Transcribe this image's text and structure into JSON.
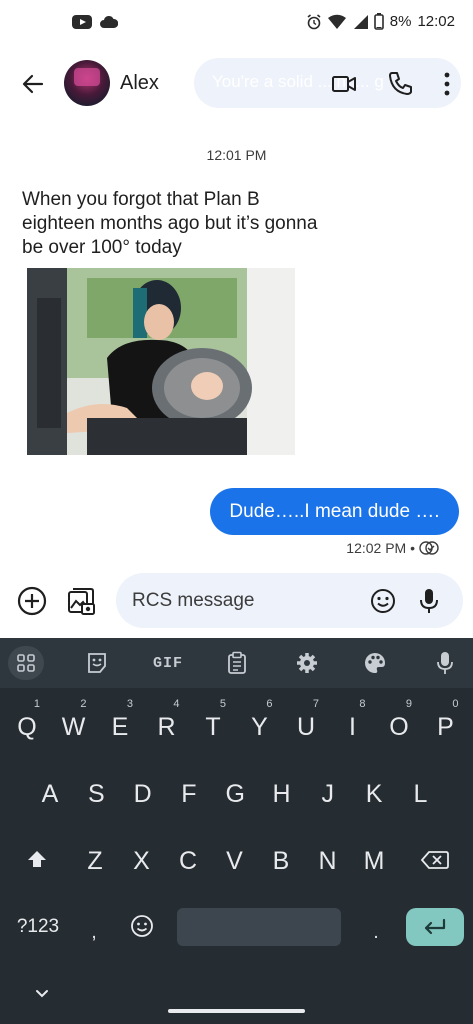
{
  "status_bar": {
    "battery": "8%",
    "time": "12:02",
    "icons": [
      "youtube-icon",
      "cloud-icon",
      "alarm-icon",
      "wifi-icon",
      "signal-icon",
      "battery-icon"
    ]
  },
  "header": {
    "contact_name": "Alex",
    "pill_text": "You're a solid ... nt ... g",
    "icons": [
      "back-arrow-icon",
      "video-call-icon",
      "phone-icon",
      "more-vert-icon"
    ]
  },
  "conversation": {
    "timestamp": "12:01 PM",
    "incoming": {
      "text": "When you forgot that Plan B eighteen months ago but it’s gonna be over 100° today"
    },
    "outgoing": {
      "text": "Dude…..I mean dude ….",
      "status": "12:02 PM •"
    }
  },
  "compose": {
    "placeholder": "RCS message",
    "icons": [
      "add-circle-icon",
      "gallery-icon",
      "emoji-icon",
      "mic-icon"
    ]
  },
  "keyboard": {
    "toolbar": {
      "gif": "GIF"
    },
    "row1": [
      "Q",
      "W",
      "E",
      "R",
      "T",
      "Y",
      "U",
      "I",
      "O",
      "P"
    ],
    "row1_hints": [
      "1",
      "2",
      "3",
      "4",
      "5",
      "6",
      "7",
      "8",
      "9",
      "0"
    ],
    "row2": [
      "A",
      "S",
      "D",
      "F",
      "G",
      "H",
      "J",
      "K",
      "L"
    ],
    "row3": [
      "Z",
      "X",
      "C",
      "V",
      "B",
      "N",
      "M"
    ],
    "symbols_key": "?123",
    "comma_key": ",",
    "period_key": "."
  },
  "colors": {
    "accent_blue": "#1a73e8",
    "keyboard_bg": "#252c32",
    "enter_key": "#82c7c0",
    "pill_bg": "#eef2fb"
  }
}
